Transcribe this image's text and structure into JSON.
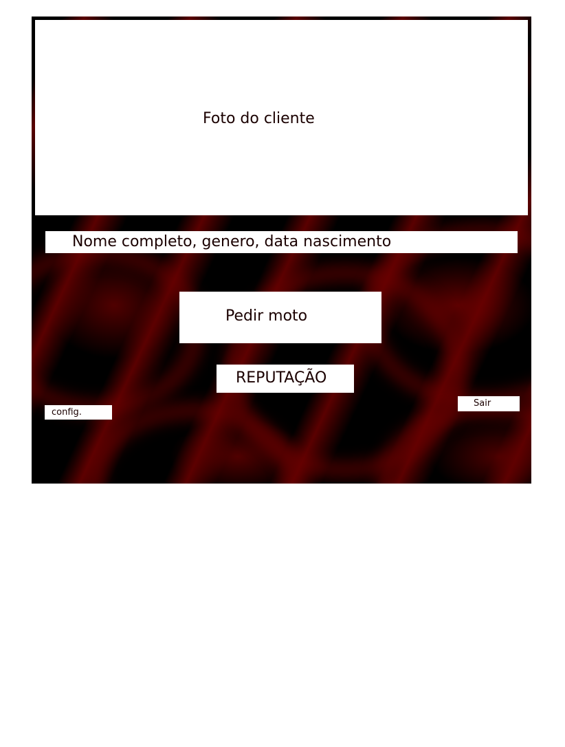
{
  "profile": {
    "photo_placeholder": "Foto do cliente",
    "info_placeholder": "Nome completo, genero, data nascimento"
  },
  "actions": {
    "order_label": "Pedir moto",
    "reputation_label": "REPUTAÇÃO",
    "config_label": "config.",
    "exit_label": "Sair"
  },
  "colors": {
    "background_dark": "#000000",
    "background_accent": "#5a0000",
    "panel": "#ffffff",
    "text": "#1a0000"
  }
}
